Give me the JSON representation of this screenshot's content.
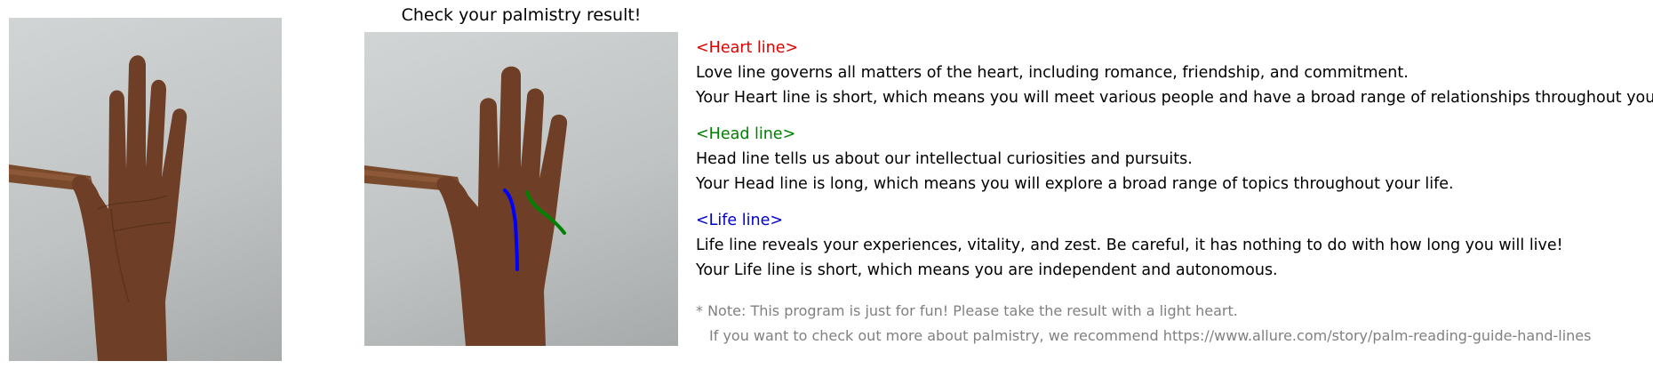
{
  "result_title": "Check your palmistry result!",
  "colors": {
    "heart": "#e00000",
    "head": "#008000",
    "life": "#0000cc",
    "note": "#808080"
  },
  "sections": {
    "heart": {
      "header": "<Heart line>",
      "description": "Love line governs all matters of the heart, including romance, friendship, and commitment.",
      "result": "Your Heart line is short, which means you will meet various people and have a broad range of relationships throughout your life."
    },
    "head": {
      "header": "<Head line>",
      "description": "Head line tells us about our intellectual curiosities and pursuits.",
      "result": "Your Head line is long, which means you will explore a broad range of topics throughout your life."
    },
    "life": {
      "header": "<Life line>",
      "description": "Life line reveals your experiences, vitality, and zest. Be careful, it has nothing to do with how long you will live!",
      "result": "Your Life line is short, which means you are independent and autonomous."
    }
  },
  "note": {
    "line1": "* Note: This program is just for fun! Please take the result with a light heart.",
    "line2": "If you want to check out more about palmistry, we recommend https://www.allure.com/story/palm-reading-guide-hand-lines"
  }
}
